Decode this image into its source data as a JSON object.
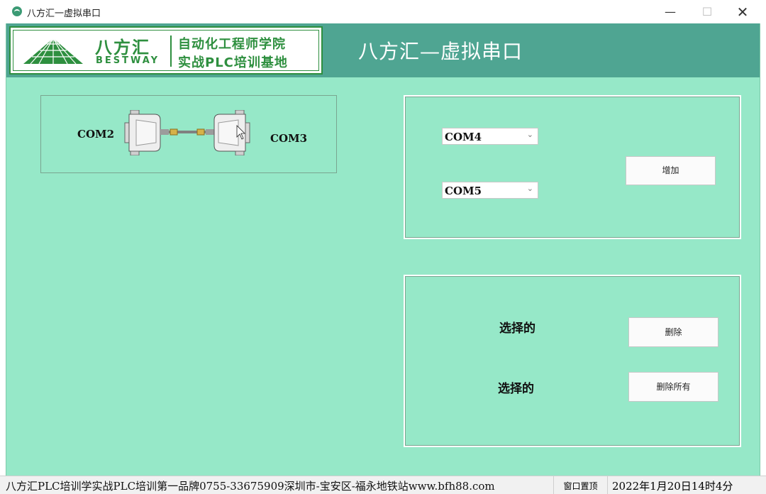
{
  "window": {
    "title": "八方汇一虚拟串口",
    "minimize_label": "—",
    "maximize_label": "☐",
    "close_label": "✕"
  },
  "header": {
    "logo": {
      "brand_cn": "八方汇",
      "brand_en": "BESTWAY",
      "line1": "自动化工程师学院",
      "line2": "实战PLC培训基地"
    },
    "app_title": "八方汇—虚拟串口"
  },
  "port_pair": {
    "left_port": "COM2",
    "right_port": "COM3"
  },
  "add_panel": {
    "port_a": "COM4",
    "port_b": "COM5",
    "add_label": "增加"
  },
  "delete_panel": {
    "selected_label_1": "选择的",
    "delete_label": "删除",
    "selected_label_2": "选择的",
    "delete_all_label": "删除所有"
  },
  "statusbar": {
    "info": "八方汇PLC培训学实战PLC培训第一品牌0755-33675909深圳市-宝安区-福永地铁站www.bfh88.com",
    "pin_label": "窗口置顶",
    "datetime": "2022年1月20日14时4分"
  },
  "colors": {
    "accent": "#4fa592",
    "background": "#96e8c8",
    "logo_green": "#2e8f3f"
  }
}
